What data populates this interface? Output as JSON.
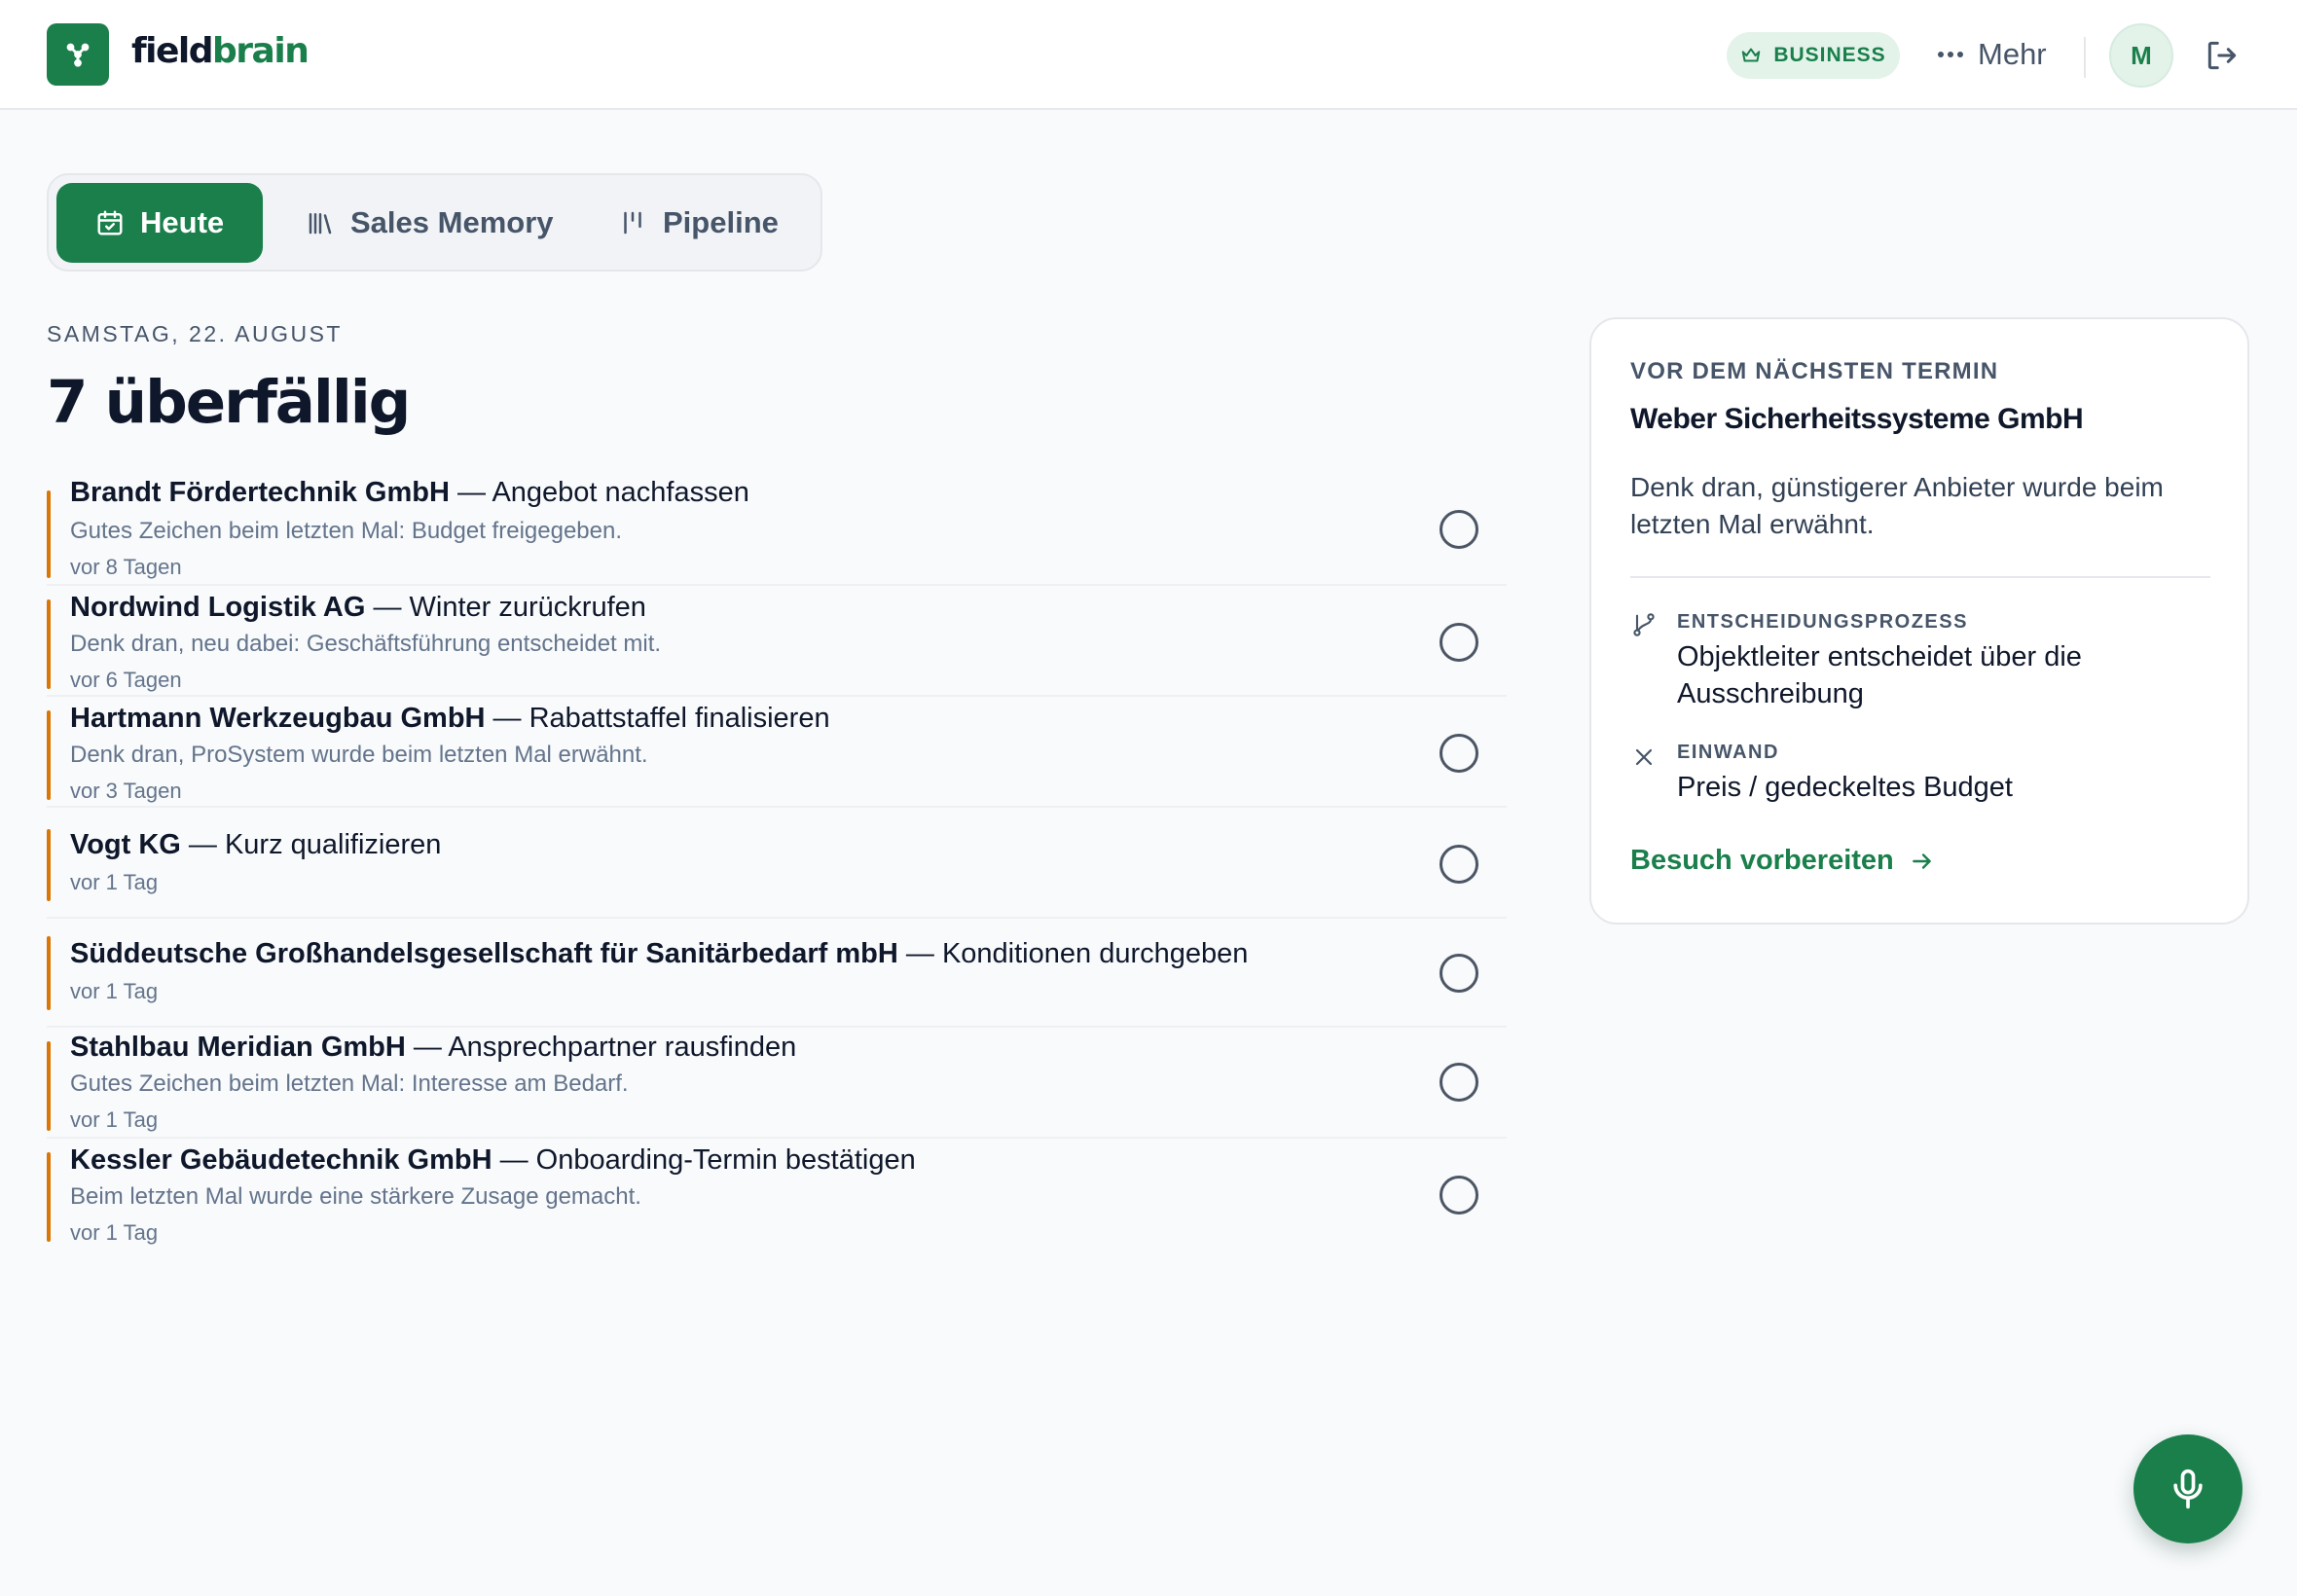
{
  "app": {
    "name_part1": "field",
    "name_part2": "brain"
  },
  "header": {
    "plan_badge": "BUSINESS",
    "more_label": "Mehr",
    "avatar_initial": "M"
  },
  "tabs": [
    {
      "label": "Heute",
      "active": true,
      "icon": "calendar-check-icon"
    },
    {
      "label": "Sales Memory",
      "active": false,
      "icon": "library-icon"
    },
    {
      "label": "Pipeline",
      "active": false,
      "icon": "pipeline-icon"
    }
  ],
  "main": {
    "date_label": "SAMSTAG, 22. AUGUST",
    "title": "7 überfällig"
  },
  "tasks": [
    {
      "company": "Brandt Fördertechnik GmbH",
      "action": " — Angebot nachfassen",
      "note": "Gutes Zeichen beim letzten Mal: Budget freigegeben.",
      "age": "vor 8 Tagen"
    },
    {
      "company": "Nordwind Logistik AG",
      "action": " — Winter zurückrufen",
      "note": "Denk dran, neu dabei: Geschäftsführung entscheidet mit.",
      "age": "vor 6 Tagen"
    },
    {
      "company": "Hartmann Werkzeugbau GmbH",
      "action": " — Rabattstaffel finalisieren",
      "note": "Denk dran, ProSystem wurde beim letzten Mal erwähnt.",
      "age": "vor 3 Tagen"
    },
    {
      "company": "Vogt KG",
      "action": " — Kurz qualifizieren",
      "note": "",
      "age": "vor 1 Tag"
    },
    {
      "company": "Süddeutsche Großhandelsgesellschaft für Sanitärbedarf mbH",
      "action": " — Konditionen durchgeben",
      "note": "",
      "age": "vor 1 Tag"
    },
    {
      "company": "Stahlbau Meridian GmbH",
      "action": " — Ansprechpartner rausfinden",
      "note": "Gutes Zeichen beim letzten Mal: Interesse am Bedarf.",
      "age": "vor 1 Tag"
    },
    {
      "company": "Kessler Gebäudetechnik GmbH",
      "action": " — Onboarding-Termin bestätigen",
      "note": "Beim letzten Mal wurde eine stärkere Zusage gemacht.",
      "age": "vor 1 Tag"
    }
  ],
  "next_meeting": {
    "kicker": "VOR DEM NÄCHSTEN TERMIN",
    "company": "Weber Sicherheitssysteme GmbH",
    "hint": "Denk dran, günstigerer Anbieter wurde beim letzten Mal erwähnt.",
    "facts": [
      {
        "label": "ENTSCHEIDUNGSPROZESS",
        "value": "Objektleiter entscheidet über die Ausschreibung",
        "icon": "branch-icon"
      },
      {
        "label": "EINWAND",
        "value": "Preis / gedeckeltes Budget",
        "icon": "x-icon"
      }
    ],
    "cta": "Besuch vorbereiten"
  },
  "colors": {
    "brand": "#1a7f4b",
    "overdue_accent": "#d97706",
    "background": "#f8fafc"
  }
}
